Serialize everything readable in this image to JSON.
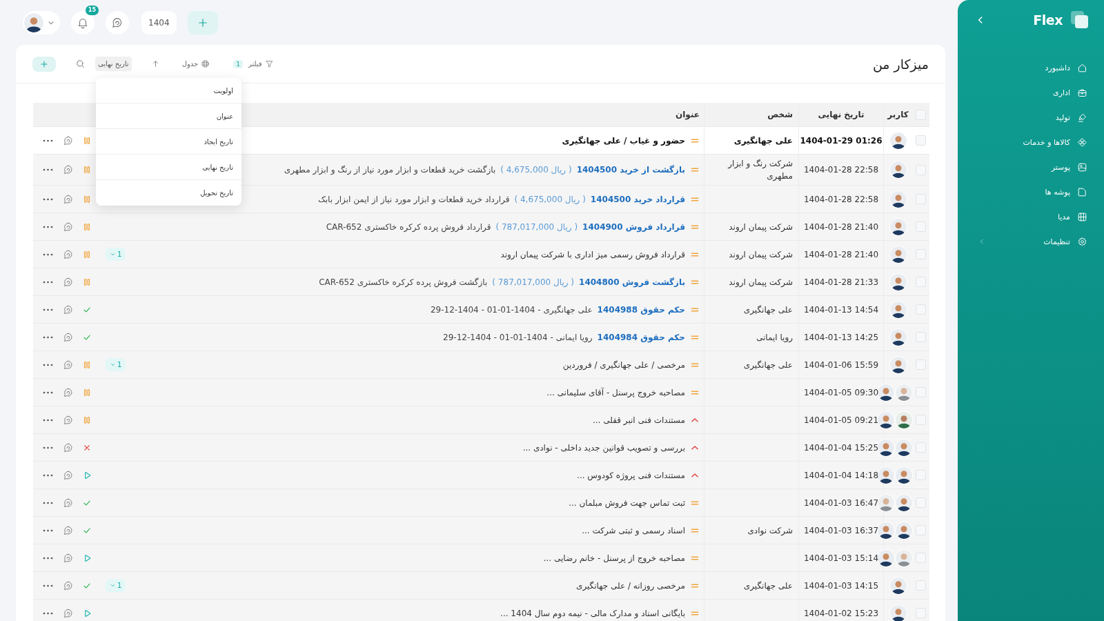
{
  "topbar": {
    "notification_count": "15",
    "year": "1404"
  },
  "page": {
    "title": "میزکار من"
  },
  "toolbar": {
    "filter": {
      "label": "فیلتر",
      "count": "1"
    },
    "view": {
      "label": "جدول"
    },
    "sort": {
      "label": "تاریخ نهایی",
      "direction": {
        "kind": "ascending"
      }
    }
  },
  "sort_menu": {
    "open": true,
    "items": [
      {
        "label": "اولویت",
        "selected": false
      },
      {
        "label": "عنوان",
        "selected": false
      },
      {
        "label": "تاریخ ایجاد",
        "selected": false
      },
      {
        "label": "تاریخ نهایی",
        "selected": false
      },
      {
        "label": "تاریخ تحویل",
        "selected": false
      }
    ]
  },
  "table": {
    "all_checked": false,
    "columns": [
      "کاربر",
      "تاریخ نهایی",
      "شخص",
      "عنوان"
    ],
    "rows": [
      {
        "checked": false,
        "highlighted": true,
        "avatars": [
          {
            "kind": "navy"
          }
        ],
        "date": "1404-01-29 01:26",
        "person": "علی جهانگیری",
        "priority": {
          "kind": "medium"
        },
        "text": "حضور و غیاب / علی جهانگیری",
        "status": {
          "kind": "pending"
        }
      },
      {
        "checked": false,
        "highlighted": false,
        "avatars": [
          {
            "kind": "navy"
          }
        ],
        "date": "1404-01-28 22:58",
        "person": "شرکت رنگ و ابزار مطهری",
        "priority": {
          "kind": "medium"
        },
        "link": "بازگشت از خرید 1404500",
        "amount": "( 4,675,000 ریال )",
        "text": "بازگشت خرید قطعات و ابزار مورد نیاز از رنگ و ابزار مطهری",
        "status": {
          "kind": "pending"
        }
      },
      {
        "checked": false,
        "highlighted": false,
        "avatars": [
          {
            "kind": "navy"
          }
        ],
        "date": "1404-01-28 22:58",
        "priority": {
          "kind": "medium"
        },
        "link": "قرارداد خرید 1404500",
        "amount": "( 4,675,000 ریال )",
        "text": "قرارداد خرید قطعات و ابزار مورد نیاز از ایمن ابزار بابک",
        "status": {
          "kind": "pending"
        }
      },
      {
        "checked": false,
        "highlighted": false,
        "avatars": [
          {
            "kind": "navy"
          }
        ],
        "date": "1404-01-28 21:40",
        "person": "شرکت پیمان اروند",
        "priority": {
          "kind": "medium"
        },
        "link": "قرارداد فروش 1404900",
        "amount": "( 787,017,000 ریال )",
        "text": "قرارداد فروش پرده کرکره خاکستری CAR-652",
        "status": {
          "kind": "pending"
        }
      },
      {
        "checked": false,
        "highlighted": false,
        "avatars": [
          {
            "kind": "navy"
          }
        ],
        "date": "1404-01-28 21:40",
        "person": "شرکت پیمان اروند",
        "priority": {
          "kind": "medium"
        },
        "text": "قرارداد فروش رسمی میز اداری با شرکت پیمان اروند",
        "status": {
          "kind": "pending"
        },
        "badge": "1"
      },
      {
        "checked": false,
        "highlighted": false,
        "avatars": [
          {
            "kind": "navy"
          }
        ],
        "date": "1404-01-28 21:33",
        "person": "شرکت پیمان اروند",
        "priority": {
          "kind": "medium"
        },
        "link": "بازگشت فروش 1404800",
        "amount": "( 787,017,000 ریال )",
        "text": "بازگشت فروش پرده کرکره خاکستری CAR-652",
        "status": {
          "kind": "pending"
        }
      },
      {
        "checked": false,
        "highlighted": false,
        "avatars": [
          {
            "kind": "navy"
          }
        ],
        "date": "1404-01-13 14:54",
        "person": "علی جهانگیری",
        "priority": {
          "kind": "medium"
        },
        "link": "حکم حقوق 1404988",
        "text": "علی جهانگیری - 1404-01-01 - 1404-12-29",
        "status": {
          "kind": "done"
        }
      },
      {
        "checked": false,
        "highlighted": false,
        "avatars": [
          {
            "kind": "navy"
          }
        ],
        "date": "1404-01-13 14:25",
        "person": "رویا ایمانی",
        "priority": {
          "kind": "medium"
        },
        "link": "حکم حقوق 1404984",
        "text": "رویا ایمانی - 1404-01-01 - 1404-12-29",
        "status": {
          "kind": "done"
        }
      },
      {
        "checked": false,
        "highlighted": false,
        "avatars": [
          {
            "kind": "navy"
          }
        ],
        "date": "1404-01-06 15:59",
        "person": "علی جهانگیری",
        "priority": {
          "kind": "medium"
        },
        "text": "مرخصی / علی جهانگیری / فروردین",
        "status": {
          "kind": "pending"
        },
        "badge": "1"
      },
      {
        "checked": false,
        "highlighted": false,
        "avatars": [
          {
            "kind": "gray"
          },
          {
            "kind": "navy"
          }
        ],
        "date": "1404-01-05 09:30",
        "priority": {
          "kind": "medium"
        },
        "text": "مصاحبه خروج پرسنل - آقای سلیمانی ...",
        "status": {
          "kind": "pending"
        }
      },
      {
        "checked": false,
        "highlighted": false,
        "avatars": [
          {
            "kind": "green"
          },
          {
            "kind": "navy"
          }
        ],
        "date": "1404-01-05 09:21",
        "priority": {
          "kind": "high"
        },
        "text": "مستندات فنی انبر قفلی ...",
        "status": {
          "kind": "pending"
        }
      },
      {
        "checked": false,
        "highlighted": false,
        "avatars": [
          {
            "kind": "navy"
          },
          {
            "kind": "navy"
          }
        ],
        "date": "1404-01-04 15:25",
        "priority": {
          "kind": "high"
        },
        "text": "بررسی و تصویب قوانین جدید داخلی - نوادی ...",
        "status": {
          "kind": "rejected"
        }
      },
      {
        "checked": false,
        "highlighted": false,
        "avatars": [
          {
            "kind": "navy"
          },
          {
            "kind": "navy"
          }
        ],
        "date": "1404-01-04 14:18",
        "priority": {
          "kind": "high"
        },
        "text": "مستندات فنی پروژه کودوس ...",
        "status": {
          "kind": "running"
        }
      },
      {
        "checked": false,
        "highlighted": false,
        "avatars": [
          {
            "kind": "navy"
          },
          {
            "kind": "gray"
          }
        ],
        "date": "1404-01-03 16:47",
        "priority": {
          "kind": "medium"
        },
        "text": "ثبت تماس جهت فروش مبلمان ...",
        "status": {
          "kind": "done"
        }
      },
      {
        "checked": false,
        "highlighted": false,
        "avatars": [
          {
            "kind": "navy"
          },
          {
            "kind": "navy"
          }
        ],
        "date": "1404-01-03 16:37",
        "person": "شرکت نوادی",
        "priority": {
          "kind": "medium"
        },
        "text": "اسناد رسمی و ثبتی شرکت ...",
        "status": {
          "kind": "done"
        }
      },
      {
        "checked": false,
        "highlighted": false,
        "avatars": [
          {
            "kind": "gray"
          },
          {
            "kind": "navy"
          }
        ],
        "date": "1404-01-03 15:14",
        "priority": {
          "kind": "medium"
        },
        "text": "مصاحبه خروج از پرسنل - خانم رضایی ...",
        "status": {
          "kind": "running"
        }
      },
      {
        "checked": false,
        "highlighted": false,
        "avatars": [
          {
            "kind": "navy"
          }
        ],
        "date": "1404-01-03 14:15",
        "person": "علی جهانگیری",
        "priority": {
          "kind": "medium"
        },
        "text": "مرخصی روزانه / علی جهانگیری",
        "status": {
          "kind": "done"
        },
        "badge": "1"
      },
      {
        "checked": false,
        "highlighted": false,
        "avatars": [
          {
            "kind": "navy"
          }
        ],
        "date": "1404-01-02 15:23",
        "priority": {
          "kind": "medium"
        },
        "text": "بایگانی اسناد و مدارک مالی - نیمه دوم سال 1404 ...",
        "status": {
          "kind": "running"
        }
      }
    ]
  },
  "sidebar": {
    "brand": "Flex",
    "items": [
      {
        "label": "داشبورد",
        "kind": "link"
      },
      {
        "label": "اداری",
        "kind": "link"
      },
      {
        "label": "تولید",
        "kind": "link"
      },
      {
        "label": "کالاها و خدمات",
        "kind": "link"
      },
      {
        "label": "پوستر",
        "kind": "link"
      },
      {
        "label": "پوشه ها",
        "kind": "link"
      },
      {
        "label": "مدیا",
        "kind": "link"
      },
      {
        "label": "تنظیمات",
        "kind": "group"
      }
    ]
  }
}
